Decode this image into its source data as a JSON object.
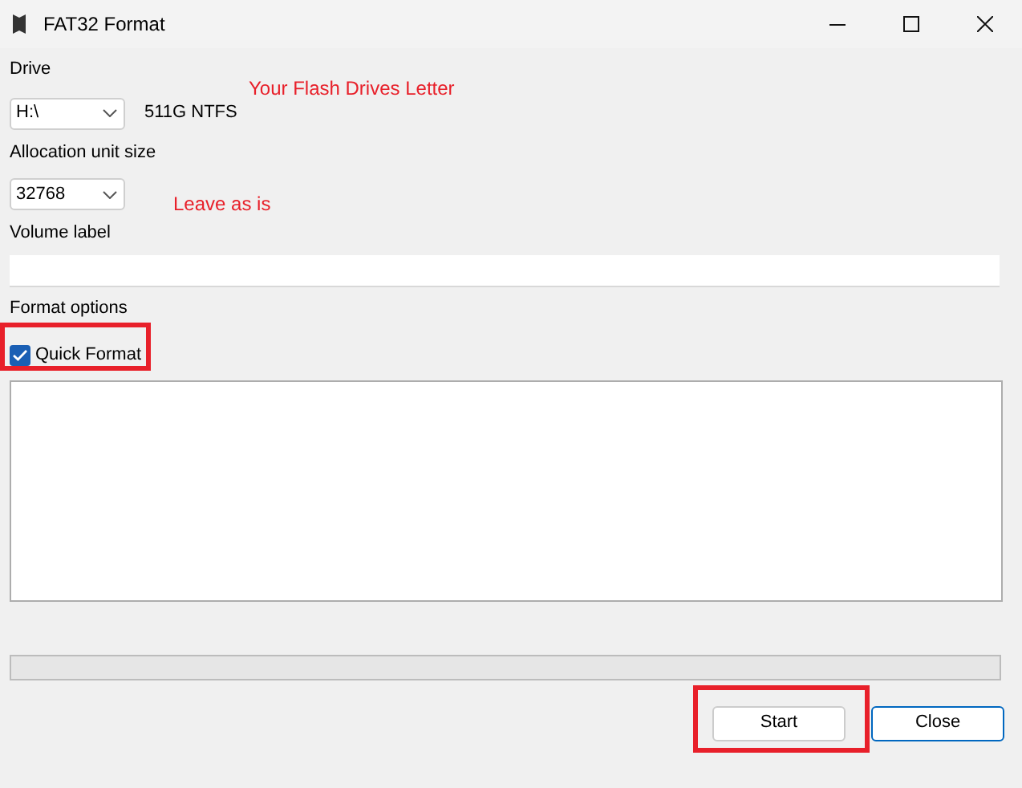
{
  "window": {
    "title": "FAT32 Format"
  },
  "drive": {
    "label": "Drive",
    "value": "H:\\",
    "info": "511G NTFS"
  },
  "allocation": {
    "label": "Allocation unit size",
    "value": "32768"
  },
  "volume": {
    "label": "Volume label"
  },
  "format_options": {
    "label": "Format options",
    "quick_format": {
      "label": "Quick Format",
      "checked": true
    }
  },
  "buttons": [
    {
      "label": "Start",
      "focused": false
    },
    {
      "label": "Close",
      "focused": true
    }
  ],
  "annotations": [
    {
      "text": "Your Flash Drives Letter"
    },
    {
      "text": "Leave as is"
    }
  ]
}
